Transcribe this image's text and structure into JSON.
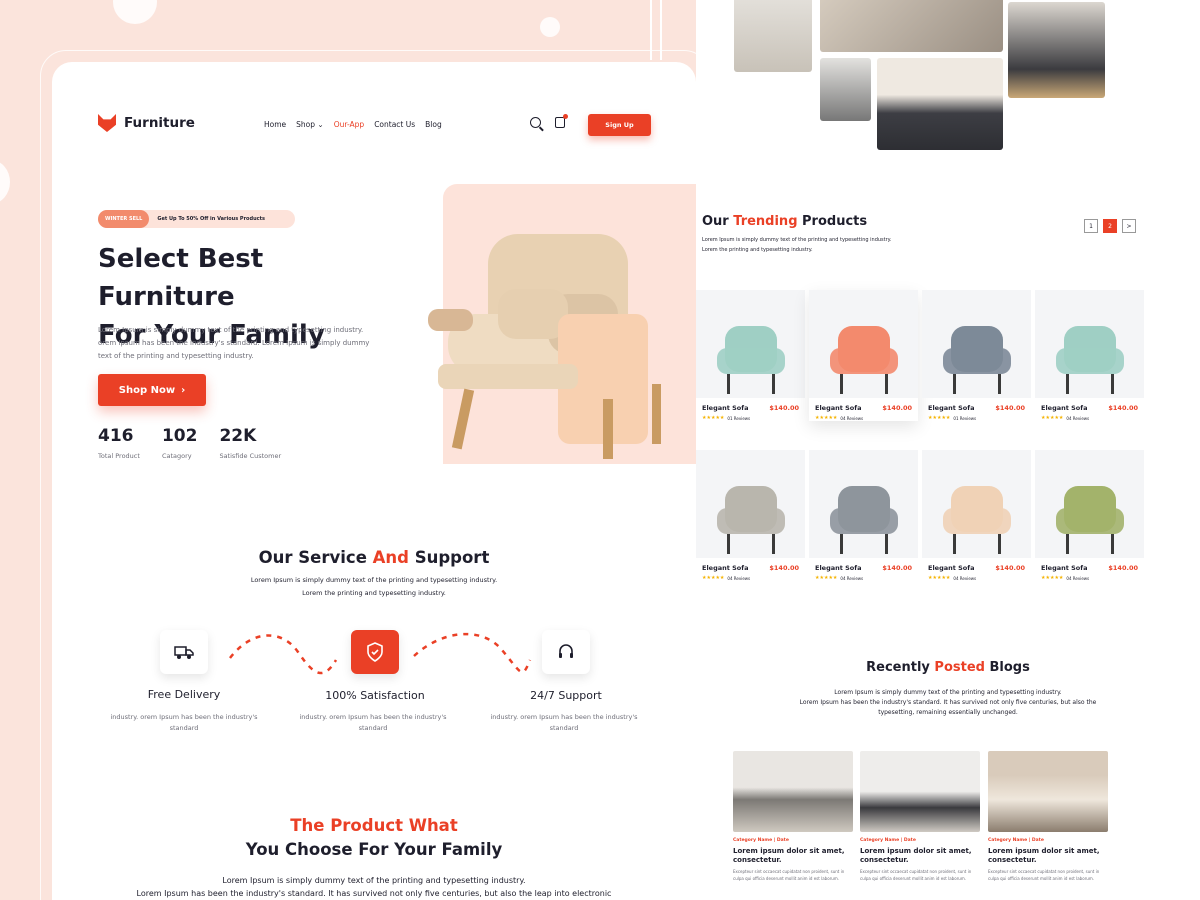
{
  "header": {
    "logo_text": "Furniture",
    "nav": [
      "Home",
      "Shop",
      "Our-App",
      "Contact Us",
      "Blog"
    ],
    "shop_chevron": "⌄",
    "signup_label": "Sign Up"
  },
  "hero": {
    "badge": "WINTER SELL",
    "badge_text": "Get Up To 50% Off in Various Products",
    "title_line1": "Select Best Furniture",
    "title_line2": "For Your Family",
    "description": "Lorem Ipsum is simply dummy text of the printing and typesetting industry. orem Ipsum has been the industry's standard. Lorem Ipsum is simply dummy text of the printing and typesetting industry.",
    "shop_label": "Shop Now",
    "shop_arrow": "›",
    "stats": [
      {
        "value": "416",
        "label": "Total Product"
      },
      {
        "value": "102",
        "label": "Catagory"
      },
      {
        "value": "22K",
        "label": "Satisfide Customer"
      }
    ]
  },
  "service": {
    "title_pre": "Our Service",
    "title_accent": "And",
    "title_post": "Support",
    "desc_line1": "Lorem Ipsum is simply dummy text of the printing and typesetting industry.",
    "desc_line2": "Lorem the printing and typesetting industry.",
    "items": [
      {
        "title": "Free Delivery",
        "desc": "industry. orem Ipsum has been the industry's standard"
      },
      {
        "title": "100% Satisfaction",
        "desc": "industry. orem Ipsum has been the industry's standard"
      },
      {
        "title": "24/7 Support",
        "desc": "industry. orem Ipsum has been the industry's standard"
      }
    ]
  },
  "choose": {
    "title_accent": "The Product What",
    "title_line2": "You Choose For Your Family",
    "desc_line1": "Lorem Ipsum is simply dummy text of the printing and typesetting industry.",
    "desc_line2": "Lorem Ipsum has been the industry's standard. It has survived not only five centuries, but also the leap into electronic"
  },
  "trending": {
    "title_pre": "Our",
    "title_accent": "Trending",
    "title_post": "Products",
    "desc_line1": "Lorem Ipsum is simply dummy text of the printing and typesetting industry.",
    "desc_line2": "Lorem the printing and typesetting industry.",
    "pages": [
      "1",
      "2",
      ">"
    ],
    "stars": "★★★★★",
    "products": [
      {
        "name": "Elegant Sofa",
        "price": "$140.00",
        "reviews": "01 Reviews",
        "color": "#9fcfc4"
      },
      {
        "name": "Elegant Sofa",
        "price": "$140.00",
        "reviews": "04 Reviews",
        "color": "#f38a6d"
      },
      {
        "name": "Elegant Sofa",
        "price": "$140.00",
        "reviews": "01 Reviews",
        "color": "#7d8a98"
      },
      {
        "name": "Elegant Sofa",
        "price": "$140.00",
        "reviews": "04 Reviews",
        "color": "#9fcfc4"
      },
      {
        "name": "Elegant Sofa",
        "price": "$140.00",
        "reviews": "04 Reviews",
        "color": "#b9b6ad"
      },
      {
        "name": "Elegant Sofa",
        "price": "$140.00",
        "reviews": "04 Reviews",
        "color": "#8e959c"
      },
      {
        "name": "Elegant Sofa",
        "price": "$140.00",
        "reviews": "04 Reviews",
        "color": "#f0d2b6"
      },
      {
        "name": "Elegant Sofa",
        "price": "$140.00",
        "reviews": "04 Reviews",
        "color": "#a3b36b"
      }
    ]
  },
  "blogs": {
    "title_pre": "Recently",
    "title_accent": "Posted",
    "title_post": "Blogs",
    "desc_line1": "Lorem Ipsum is simply dummy text of the printing and typesetting industry.",
    "desc_line2": "Lorem Ipsum has been the industry's standard. It has survived not only five centuries, but also the",
    "desc_line3": "typesetting, remaining essentially unchanged.",
    "posts": [
      {
        "category": "Category Name  |  Date",
        "title": "Lorem ipsum dolor sit amet, consectetur.",
        "desc": "Excepteur sint occaecat cupidatat non proident, sunt in culpa qui officia deserunt mollit anim id est laborum."
      },
      {
        "category": "Category Name  |  Date",
        "title": "Lorem ipsum dolor sit amet, consectetur.",
        "desc": "Excepteur sint occaecat cupidatat non proident, sunt in culpa qui officia deserunt mollit anim id est laborum."
      },
      {
        "category": "Category Name  |  Date",
        "title": "Lorem ipsum dolor sit amet, consectetur.",
        "desc": "Excepteur sint occaecat cupidatat non proident, sunt in culpa qui officia deserunt mollit anim id est laborum."
      }
    ]
  },
  "colors": {
    "accent": "#ea4026",
    "hero_bg": "#fde3da",
    "page_bg": "#fbe4dc"
  }
}
